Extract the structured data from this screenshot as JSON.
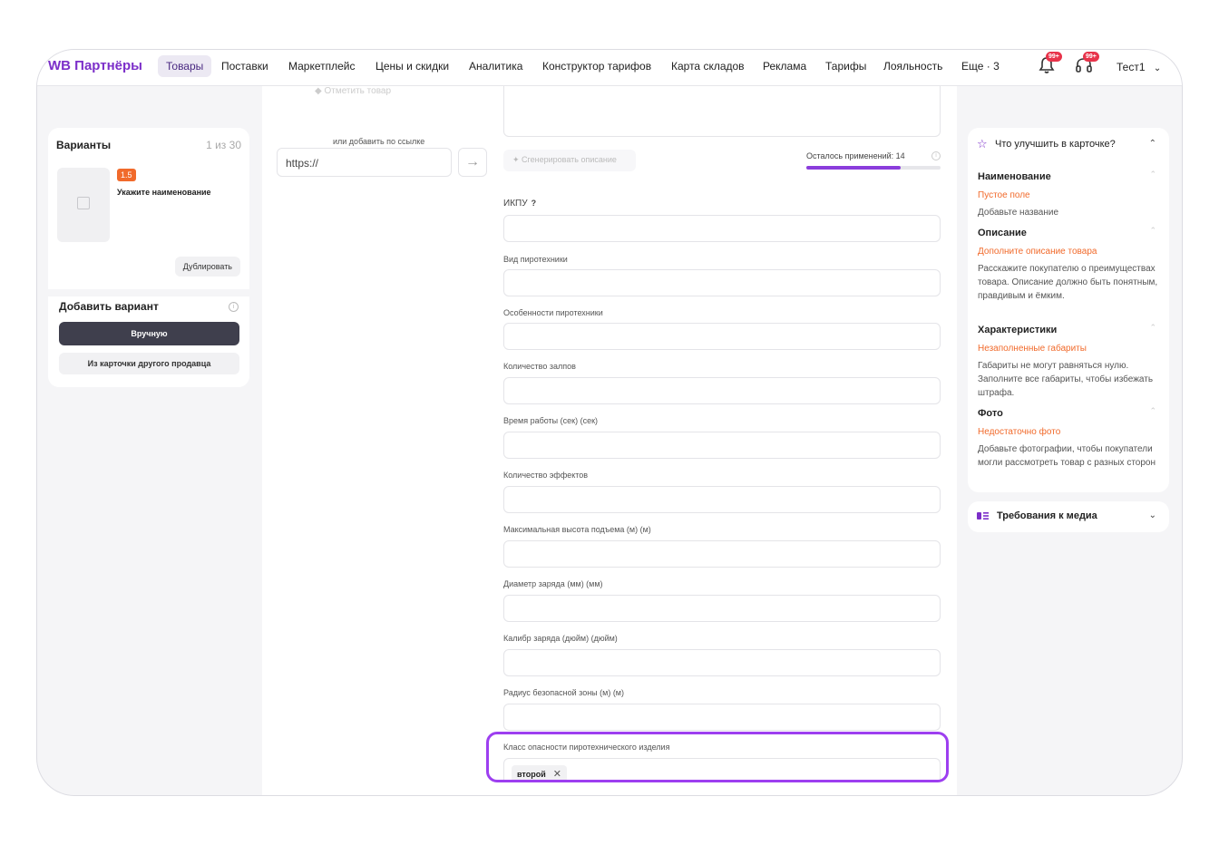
{
  "nav": {
    "logo": "WB Партнёры",
    "items": [
      "Товары",
      "Поставки",
      "Маркетплейс",
      "Цены и скидки",
      "Аналитика",
      "Конструктор тарифов",
      "Карта складов",
      "Реклама",
      "Тарифы",
      "Лояльность",
      "Еще · 3"
    ],
    "notif_badge": "99+",
    "support_badge": "99+",
    "user": "Тест1"
  },
  "variants": {
    "title": "Варианты",
    "count": "1 из 30",
    "rating": "1.5",
    "name": "Укажите наименование",
    "duplicate": "Дублировать",
    "add_title": "Добавить вариант",
    "manual": "Вручную",
    "from_card": "Из карточки другого продавца"
  },
  "media": {
    "faded_text": "Отметить товар",
    "link_label": "или добавить по ссылке",
    "url_placeholder": "https://"
  },
  "description": {
    "generate": "Сгенерировать описание",
    "remaining": "Осталось применений: 14",
    "remaining_progress": 0.7
  },
  "fields": {
    "ikpu": "ИКПУ",
    "qmark": "?",
    "kind": "Вид пиротехники",
    "features": "Особенности пиротехники",
    "volleys": "Количество залпов",
    "runtime": "Время работы (сек) (сек)",
    "effects": "Количество эффектов",
    "max_height": "Максимальная высота подъема (м) (м)",
    "diameter": "Диаметр заряда (мм) (мм)",
    "caliber": "Калибр заряда (дюйм) (дюйм)",
    "radius": "Радиус безопасной зоны (м) (м)",
    "hazard_class": "Класс опасности пиротехнического изделия",
    "hazard_value": "второй"
  },
  "improve": {
    "title": "Что улучшить в карточке?",
    "sections": [
      {
        "title": "Наименование",
        "warn": "Пустое поле",
        "text": "Добавьте название"
      },
      {
        "title": "Описание",
        "warn": "Дополните описание товара",
        "text": "Расскажите покупателю о преимуществах товара. Описание должно быть понятным, правдивым и ёмким."
      },
      {
        "title": "Характеристики",
        "warn": "Незаполненные габариты",
        "text": "Габариты не могут равняться нулю. Заполните все габариты, чтобы избежать штрафа."
      },
      {
        "title": "Фото",
        "warn": "Недостаточно фото",
        "text": "Добавьте фотографии, чтобы покупатели могли рассмотреть товар с разных сторон"
      }
    ],
    "media_requirements": "Требования к медиа"
  },
  "colors": {
    "brand": "#7c2fc9",
    "warning": "#f16a2b",
    "highlight": "#9d3ff0",
    "badge": "#e8334a"
  }
}
